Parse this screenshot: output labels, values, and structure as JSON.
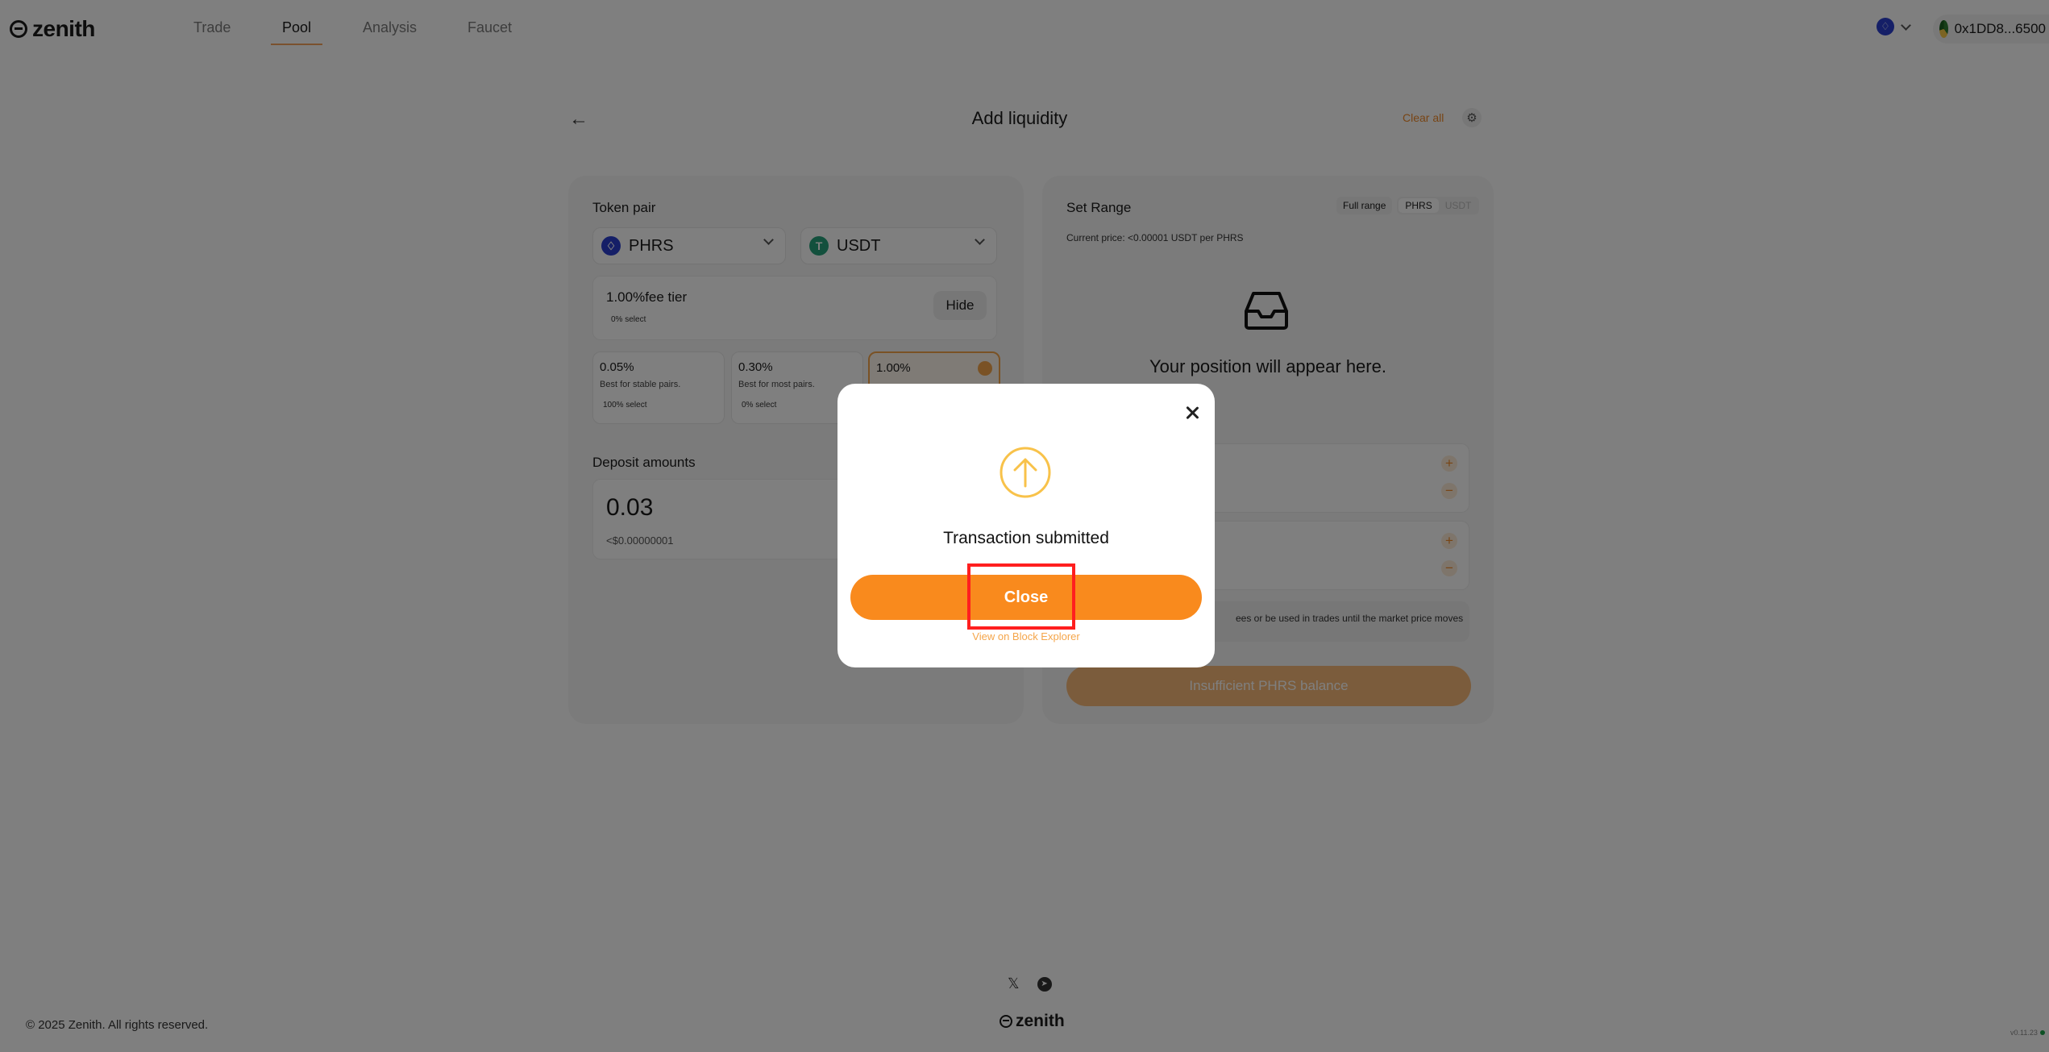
{
  "header": {
    "logo": "zenith",
    "nav": [
      "Trade",
      "Pool",
      "Analysis",
      "Faucet"
    ],
    "active_nav": "Pool",
    "network_icon": "pharos-network-icon",
    "wallet_address": "0x1DD8...6500"
  },
  "page": {
    "title": "Add liquidity",
    "clear_all": "Clear all"
  },
  "left": {
    "token_pair_label": "Token pair",
    "token_a": "PHRS",
    "token_b": "USDT",
    "fee_tier_title": "1.00%fee tier",
    "fee_tier_select": "0% select",
    "hide_label": "Hide",
    "fee_options": [
      {
        "pct": "0.05%",
        "desc": "Best for stable pairs.",
        "select": "100% select"
      },
      {
        "pct": "0.30%",
        "desc": "Best for most pairs.",
        "select": "0% select"
      },
      {
        "pct": "1.00%",
        "desc": "",
        "select": ""
      }
    ],
    "deposit_label": "Deposit amounts",
    "deposit_amount": "0.03",
    "deposit_usd": "<$0.00000001"
  },
  "right": {
    "set_range_label": "Set Range",
    "full_range": "Full range",
    "seg_phrs": "PHRS",
    "seg_usdt": "USDT",
    "current_price": "Current price: <0.00001 USDT per PHRS",
    "position_message": "Your position will appear here.",
    "notice": "ees or be used in trades until the market price moves",
    "insufficient_button": "Insufficient PHRS balance"
  },
  "footer": {
    "copyright": "© 2025 Zenith. All rights reserved.",
    "logo": "zenith",
    "version": "v0.11.23"
  },
  "modal": {
    "message": "Transaction submitted",
    "close_button": "Close",
    "explorer_link": "View on Block Explorer"
  },
  "colors": {
    "accent": "#f98a1d",
    "highlight": "#ff1f1f"
  }
}
